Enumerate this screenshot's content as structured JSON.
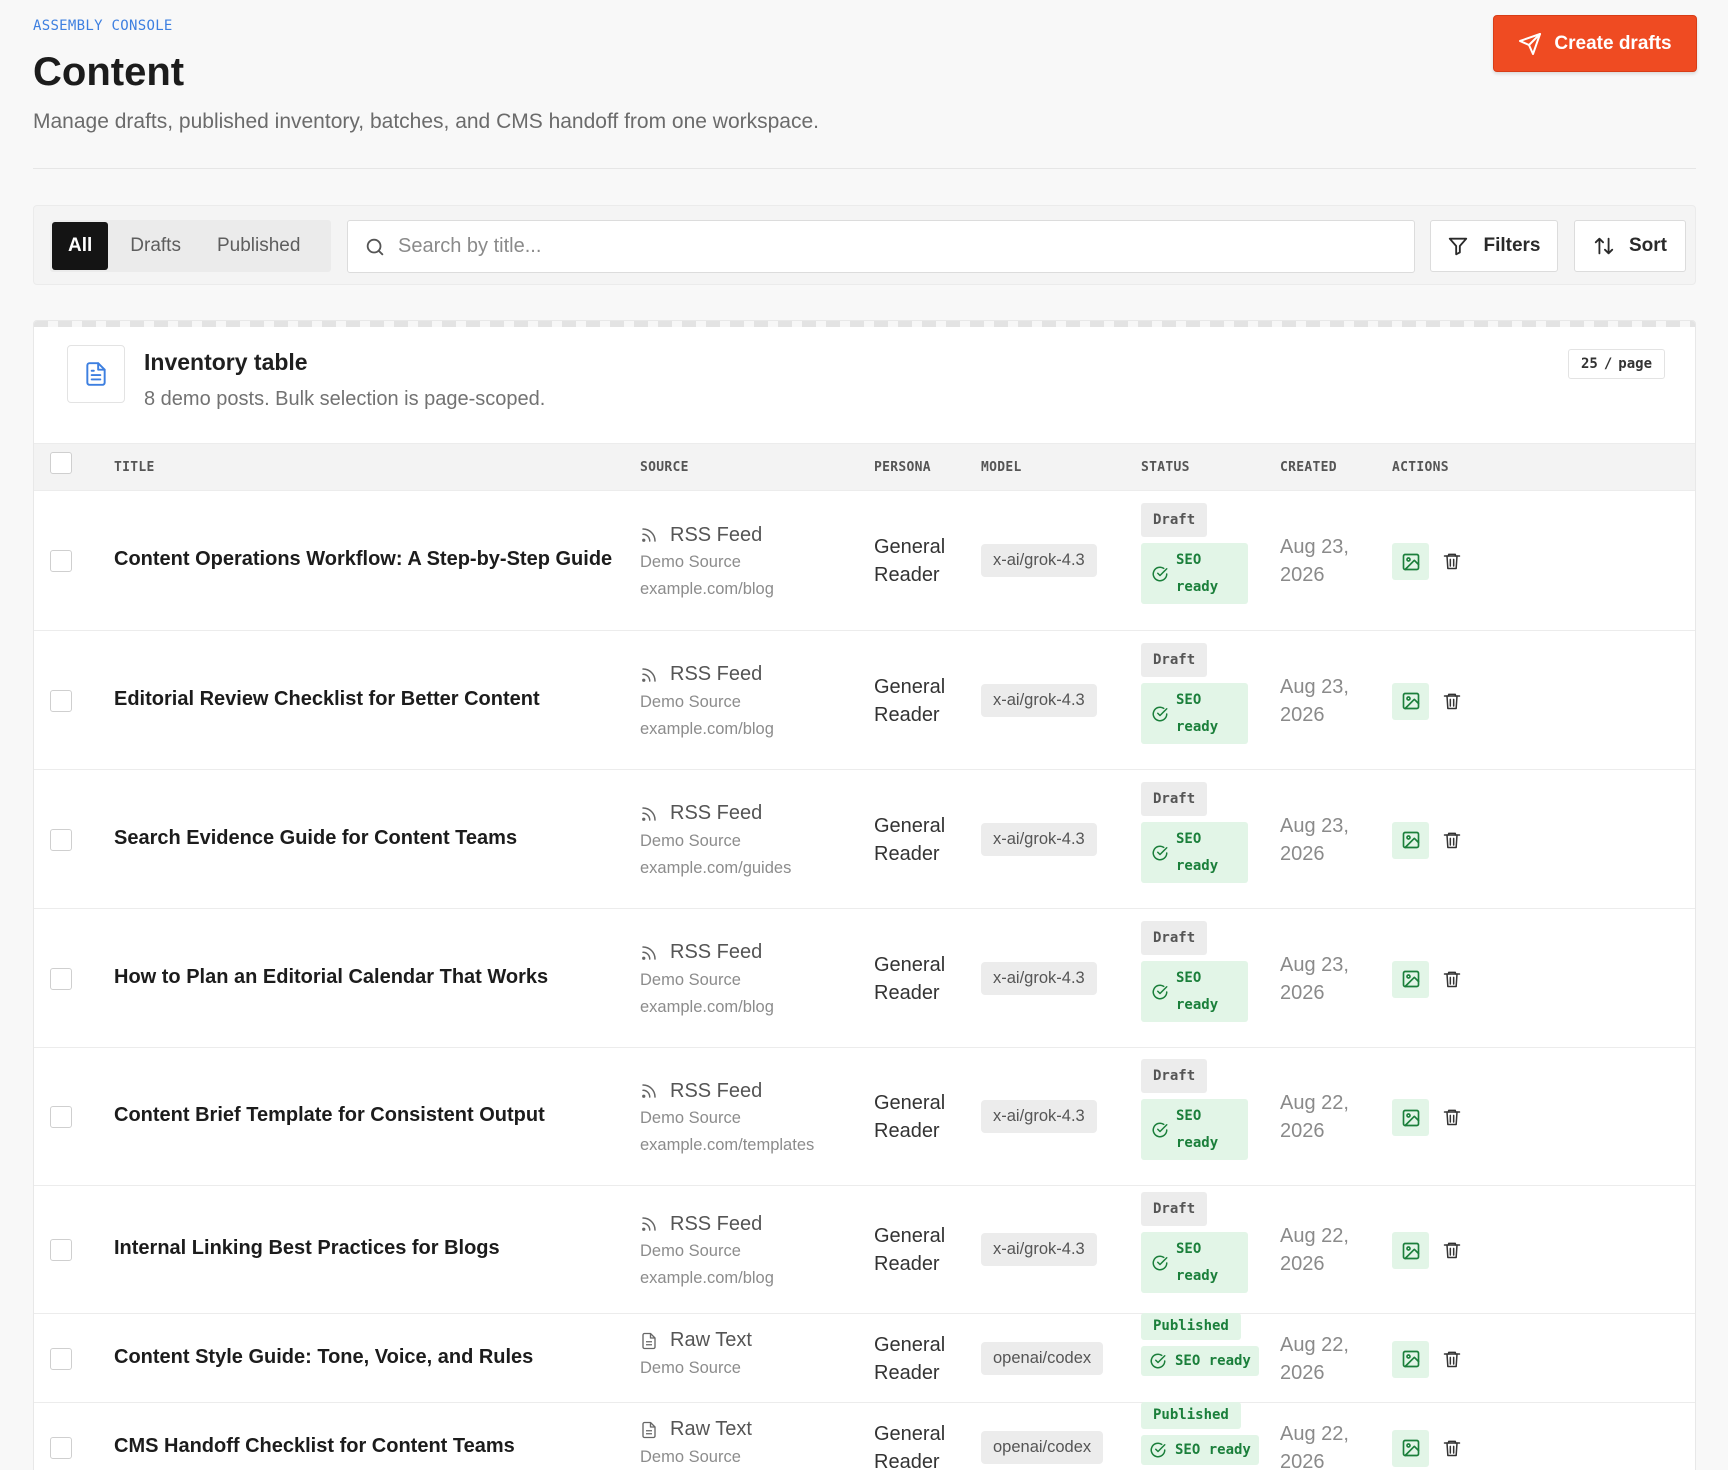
{
  "header": {
    "eyebrow": "ASSEMBLY CONSOLE",
    "title": "Content",
    "subtitle": "Manage drafts, published inventory, batches, and CMS handoff from one workspace.",
    "create_label": "Create drafts"
  },
  "toolbar": {
    "tabs": [
      "All",
      "Drafts",
      "Published"
    ],
    "active_tab": "All",
    "search_placeholder": "Search by title...",
    "filters_label": "Filters",
    "sort_label": "Sort"
  },
  "table": {
    "title": "Inventory table",
    "subtitle": "8 demo posts. Bulk selection is page-scoped.",
    "per_page_count": "25",
    "per_page_sep": "/",
    "per_page_unit": "page",
    "columns": [
      "TITLE",
      "SOURCE",
      "PERSONA",
      "MODEL",
      "STATUS",
      "CREATED",
      "ACTIONS"
    ],
    "rows": [
      {
        "title": "Content Operations Workflow: A Step-by-Step Guide",
        "source_type": "RSS Feed",
        "source_name": "Demo Source",
        "source_url": "example.com/blog",
        "persona_1": "General",
        "persona_2": "Reader",
        "model": "x-ai/grok-4.3",
        "status": "Draft",
        "seo_1": "SEO",
        "seo_2": "ready",
        "created_1": "Aug 23,",
        "created_2": "2026"
      },
      {
        "title": "Editorial Review Checklist for Better Content",
        "source_type": "RSS Feed",
        "source_name": "Demo Source",
        "source_url": "example.com/blog",
        "persona_1": "General",
        "persona_2": "Reader",
        "model": "x-ai/grok-4.3",
        "status": "Draft",
        "seo_1": "SEO",
        "seo_2": "ready",
        "created_1": "Aug 23,",
        "created_2": "2026"
      },
      {
        "title": "Search Evidence Guide for Content Teams",
        "source_type": "RSS Feed",
        "source_name": "Demo Source",
        "source_url": "example.com/guides",
        "persona_1": "General",
        "persona_2": "Reader",
        "model": "x-ai/grok-4.3",
        "status": "Draft",
        "seo_1": "SEO",
        "seo_2": "ready",
        "created_1": "Aug 23,",
        "created_2": "2026"
      },
      {
        "title": "How to Plan an Editorial Calendar That Works",
        "source_type": "RSS Feed",
        "source_name": "Demo Source",
        "source_url": "example.com/blog",
        "persona_1": "General",
        "persona_2": "Reader",
        "model": "x-ai/grok-4.3",
        "status": "Draft",
        "seo_1": "SEO",
        "seo_2": "ready",
        "created_1": "Aug 23,",
        "created_2": "2026"
      },
      {
        "title": "Content Brief Template for Consistent Output",
        "source_type": "RSS Feed",
        "source_name": "Demo Source",
        "source_url": "example.com/templates",
        "persona_1": "General",
        "persona_2": "Reader",
        "model": "x-ai/grok-4.3",
        "status": "Draft",
        "seo_1": "SEO",
        "seo_2": "ready",
        "created_1": "Aug 22,",
        "created_2": "2026"
      },
      {
        "title": "Internal Linking Best Practices for Blogs",
        "source_type": "RSS Feed",
        "source_name": "Demo Source",
        "source_url": "example.com/blog",
        "persona_1": "General",
        "persona_2": "Reader",
        "model": "x-ai/grok-4.3",
        "status": "Draft",
        "seo_1": "SEO",
        "seo_2": "ready",
        "created_1": "Aug 22,",
        "created_2": "2026"
      },
      {
        "title": "Content Style Guide: Tone, Voice, and Rules",
        "source_type": "Raw Text",
        "source_name": "Demo Source",
        "persona_1": "General",
        "persona_2": "Reader",
        "model": "openai/codex",
        "status": "Published",
        "seo": "SEO ready",
        "created_1": "Aug 22,",
        "created_2": "2026"
      },
      {
        "title": "CMS Handoff Checklist for Content Teams",
        "source_type": "Raw Text",
        "source_name": "Demo Source",
        "persona_1": "General",
        "persona_2": "Reader",
        "model": "openai/codex",
        "status": "Published",
        "seo": "SEO ready",
        "created_1": "Aug 22,",
        "created_2": "2026"
      }
    ]
  }
}
